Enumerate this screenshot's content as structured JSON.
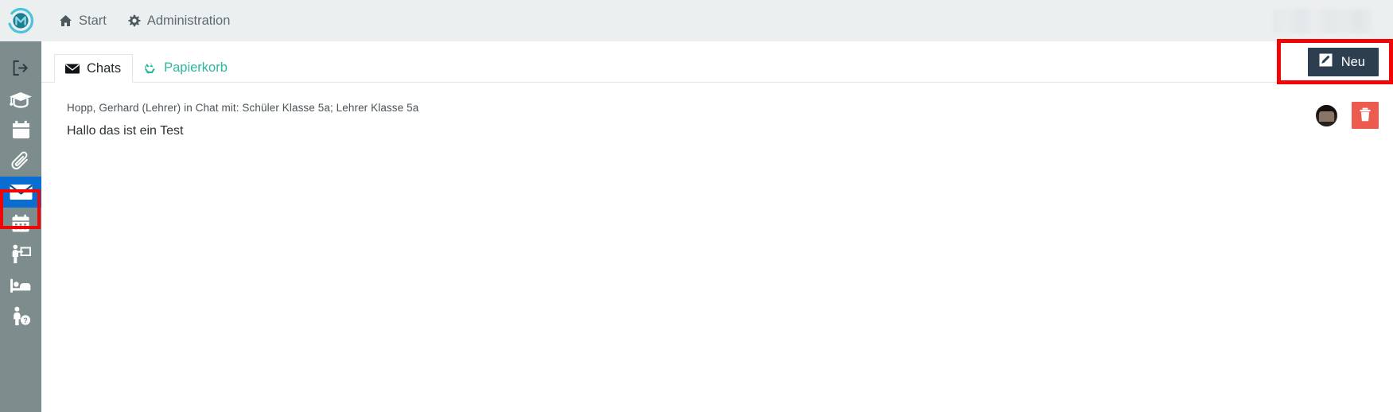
{
  "app": {
    "logo_name": "schulportal-logo",
    "redacted_region": "user-account-redacted"
  },
  "topnav": {
    "items": [
      {
        "label": "Start",
        "icon": "home-icon"
      },
      {
        "label": "Administration",
        "icon": "gear-icon"
      }
    ]
  },
  "sidebar": {
    "items": [
      {
        "icon": "logout-icon",
        "name": "sidebar-item-logout",
        "active": false
      },
      {
        "icon": "graduation-cap-icon",
        "name": "sidebar-item-classes",
        "active": false
      },
      {
        "icon": "calendar-icon",
        "name": "sidebar-item-calendar",
        "active": false
      },
      {
        "icon": "paperclip-icon",
        "name": "sidebar-item-attachments",
        "active": false
      },
      {
        "icon": "envelope-icon",
        "name": "sidebar-item-messages",
        "active": true
      },
      {
        "icon": "calendar-grid-icon",
        "name": "sidebar-item-timetable",
        "active": false
      },
      {
        "icon": "teacher-board-icon",
        "name": "sidebar-item-lessons",
        "active": false
      },
      {
        "icon": "bed-icon",
        "name": "sidebar-item-boarding",
        "active": false
      },
      {
        "icon": "person-help-icon",
        "name": "sidebar-item-help",
        "active": false
      }
    ]
  },
  "tabs": [
    {
      "label": "Chats",
      "icon": "envelope-icon",
      "selected": true
    },
    {
      "label": "Papierkorb",
      "icon": "recycle-icon",
      "selected": false
    }
  ],
  "toolbar": {
    "new_label": "Neu",
    "new_icon": "pencil-square-icon"
  },
  "messages": [
    {
      "meta": "Hopp, Gerhard (Lehrer) in Chat mit: Schüler Klasse 5a; Lehrer Klasse 5a",
      "body": "Hallo das ist ein Test",
      "avatar": "user-avatar",
      "delete_icon": "trash-icon"
    }
  ],
  "colors": {
    "header_bg": "#eceff0",
    "sidebar_bg": "#7d8c8c",
    "sidebar_active": "#0a6dd1",
    "highlight_box": "#f20505",
    "accent_teal": "#2eb6a0",
    "button_dark": "#2d3e50",
    "delete_red": "#ec5b4e"
  }
}
